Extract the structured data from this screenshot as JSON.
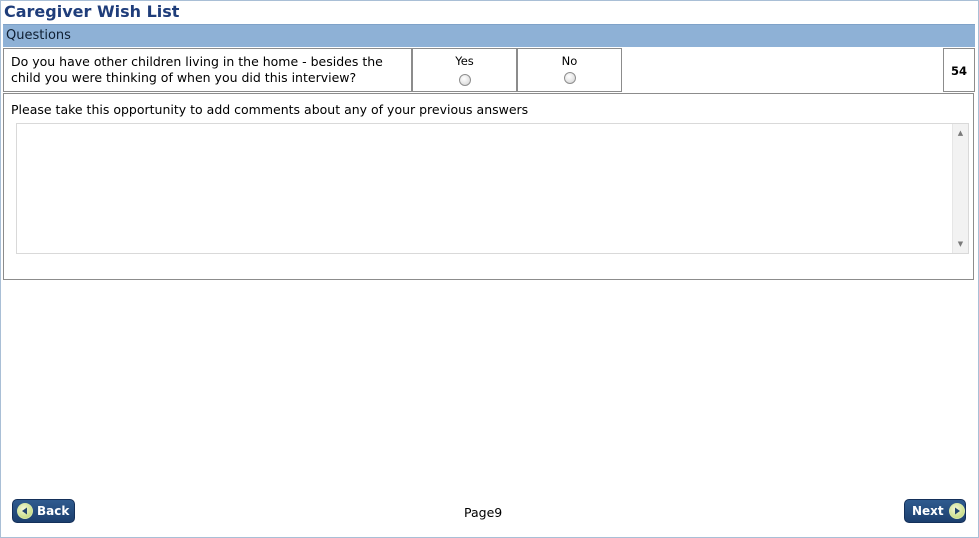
{
  "page": {
    "title": "Caregiver Wish List",
    "section_header": "Questions"
  },
  "question": {
    "text": "Do you have other children living in the home - besides the child you were thinking of when you did this interview?",
    "options": [
      {
        "label": "Yes",
        "selected": false
      },
      {
        "label": "No",
        "selected": false
      }
    ],
    "number": "54"
  },
  "comments": {
    "label": "Please take this opportunity to add comments about any of your previous answers",
    "value": ""
  },
  "footer": {
    "back_label": "Back",
    "next_label": "Next",
    "page_indicator": "Page9"
  },
  "colors": {
    "title": "#1f3d7a",
    "header_bg": "#8eb1d6",
    "button_bg": "#1c3f6e",
    "button_icon": "#b9d36a"
  },
  "icons": {
    "back": "arrow-left-circle-icon",
    "next": "arrow-right-circle-icon"
  }
}
